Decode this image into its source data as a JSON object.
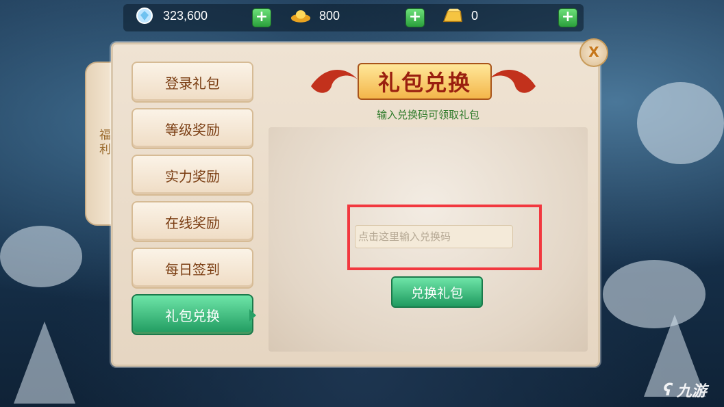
{
  "currency": [
    {
      "icon": "diamond-icon",
      "value": "323,600"
    },
    {
      "icon": "gold-ingot-icon",
      "value": "800"
    },
    {
      "icon": "gold-bar-icon",
      "value": "0"
    }
  ],
  "plus_label": "+",
  "close_label": "X",
  "side_tab": {
    "label": "福利"
  },
  "menu": [
    {
      "label": "登录礼包",
      "active": false
    },
    {
      "label": "等级奖励",
      "active": false
    },
    {
      "label": "实力奖励",
      "active": false
    },
    {
      "label": "在线奖励",
      "active": false
    },
    {
      "label": "每日签到",
      "active": false
    },
    {
      "label": "礼包兑换",
      "active": true
    }
  ],
  "content": {
    "title": "礼包兑换",
    "subtitle": "输入兑换码可领取礼包",
    "input_placeholder": "点击这里输入兑换码",
    "input_value": "",
    "button_label": "兑换礼包"
  },
  "watermark": {
    "logo": "ʕ",
    "text": "九游"
  },
  "colors": {
    "accent_green": "#1f9a5f",
    "highlight_red": "#f2383f",
    "title_red": "#9a1f0f"
  }
}
